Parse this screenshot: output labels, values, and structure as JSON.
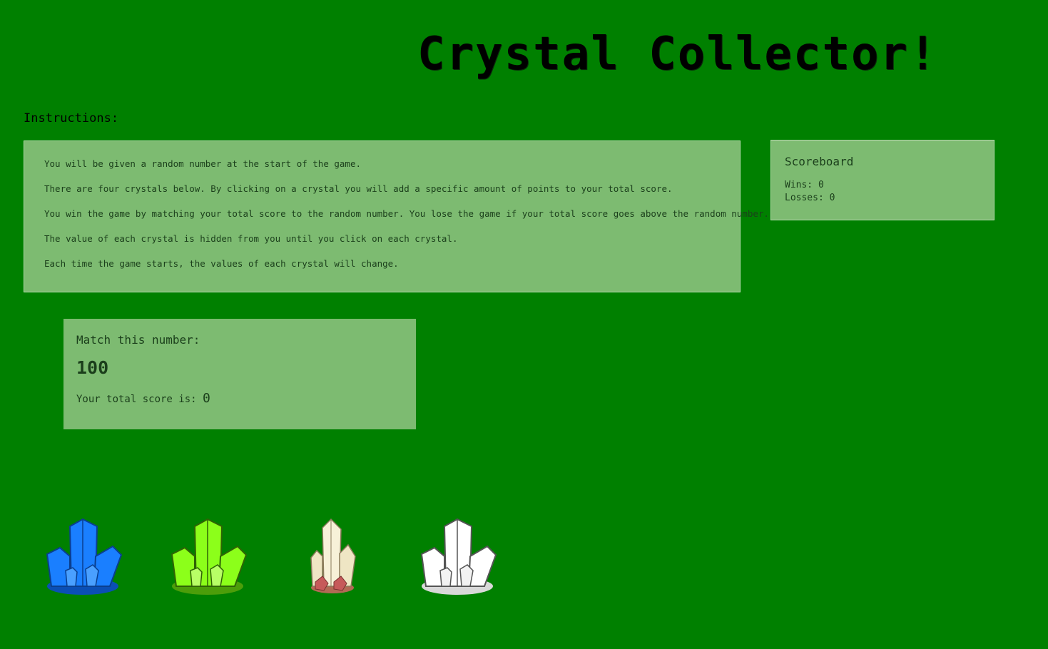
{
  "title": "Crystal Collector!",
  "instructions": {
    "label": "Instructions:",
    "lines": [
      "You will be given a random number at the start of the game.",
      "There are four crystals below. By clicking on a crystal you will add a specific amount of points to your total score.",
      "You win the game by matching your total score to the random number. You lose the game if your total score goes above the random number.",
      "The value of each crystal is hidden from you until you click on each crystal.",
      "Each time the game starts, the values of each crystal will change."
    ]
  },
  "scoreboard": {
    "title": "Scoreboard",
    "wins_label": "Wins:",
    "wins": "0",
    "losses_label": "Losses:",
    "losses": "0"
  },
  "match": {
    "label": "Match this number:",
    "target": "100",
    "total_label": "Your total score is:",
    "total": "0"
  },
  "crystals": [
    {
      "name": "blue-crystal-icon",
      "color": "#1a7fff",
      "dark": "#0b4fb5"
    },
    {
      "name": "green-crystal-icon",
      "color": "#8cff1a",
      "dark": "#4c9e0a"
    },
    {
      "name": "yellow-crystal-icon",
      "color": "#f2ecd0",
      "dark": "#b26a55"
    },
    {
      "name": "white-crystal-icon",
      "color": "#ffffff",
      "dark": "#c9c9c9"
    }
  ],
  "colors": {
    "background": "#008000",
    "panel": "#7dbb71",
    "panel_text": "#1b3f1b"
  }
}
